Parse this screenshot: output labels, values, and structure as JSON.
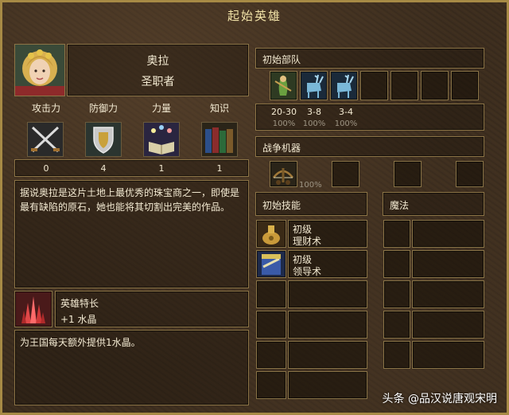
{
  "window": {
    "title": "起始英雄"
  },
  "hero": {
    "name": "奥拉",
    "class": "圣职者",
    "portrait_icon": "hero-portrait"
  },
  "primary_stats": [
    {
      "label": "攻击力",
      "value": "0",
      "icon": "crossed-swords-icon"
    },
    {
      "label": "防御力",
      "value": "4",
      "icon": "shield-icon"
    },
    {
      "label": "力量",
      "value": "1",
      "icon": "spellbook-icon"
    },
    {
      "label": "知识",
      "value": "1",
      "icon": "books-icon"
    }
  ],
  "biography": "据说奥拉是这片土地上最优秀的珠宝商之一，即使是最有缺陷的原石，她也能将其切割出完美的作品。",
  "specialty": {
    "title": "英雄特长",
    "value": "+1 水晶",
    "description": "为王国每天额外提供1水晶。",
    "icon": "crystal-icon"
  },
  "army": {
    "title": "初始部队",
    "units": [
      {
        "icon": "dryad-unit-icon",
        "count": "20-30",
        "percent": "100%"
      },
      {
        "icon": "deer-unit-icon",
        "count": "3-8",
        "percent": "100%"
      },
      {
        "icon": "deer-unit-icon",
        "count": "3-4",
        "percent": "100%"
      }
    ]
  },
  "war_machines": {
    "title": "战争机器",
    "items": [
      {
        "icon": "ballista-icon",
        "percent": "100%"
      }
    ]
  },
  "skills": {
    "title": "初始技能",
    "items": [
      {
        "level": "初级",
        "name": "理财术",
        "icon": "estates-skill-icon"
      },
      {
        "level": "初级",
        "name": "领导术",
        "icon": "leadership-skill-icon"
      }
    ]
  },
  "magic": {
    "title": "魔法"
  },
  "watermark": "头条 @品汉说唐观宋明",
  "colors": {
    "frame": "#a78a45",
    "gold_text": "#f0d880",
    "panel_border": "#8c7446"
  }
}
